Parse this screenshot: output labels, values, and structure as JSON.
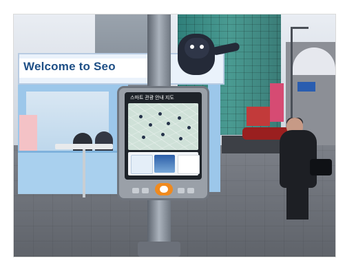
{
  "image": {
    "booth_sign": "Welcome to Seo",
    "kiosk_title": "스마트 관광 안내 지도"
  },
  "colors": {
    "booth_blue": "#9cc7ea",
    "booth_text": "#1e4f86",
    "kiosk_orange": "#f08a1e",
    "glass_building": "#3a7c77"
  },
  "icons": {
    "kiosk_logo": "circle-logo-icon"
  }
}
